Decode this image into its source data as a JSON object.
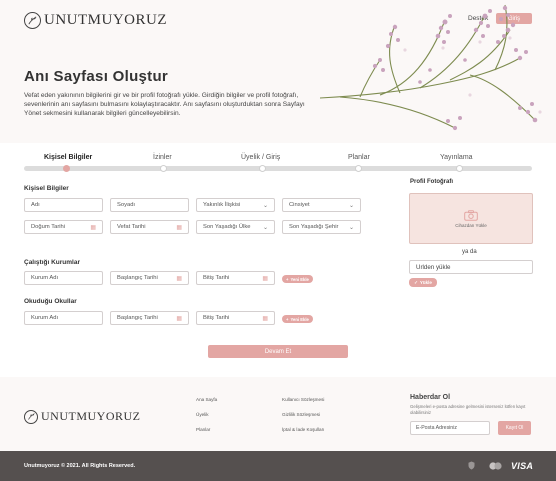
{
  "header": {
    "logo_text": "UNUTMUYORUZ",
    "support_link": "Destek",
    "login_button": "Giriş"
  },
  "hero": {
    "title": "Anı Sayfası Oluştur",
    "description": "Vefat eden yakınının bilgilerini gir ve bir profil fotoğrafı yükle. Girdiğin bilgiler ve profil fotoğrafı, sevenlerinin anı sayfasını bulmasını kolaylaştıracaktır. Anı sayfasını oluşturduktan sonra Sayfayı Yönet sekmesini kullanarak bilgileri güncelleyebilirsin."
  },
  "steps": [
    {
      "label": "Kişisel Bilgiler",
      "active": true
    },
    {
      "label": "İzinler",
      "active": false
    },
    {
      "label": "Üyelik / Giriş",
      "active": false
    },
    {
      "label": "Planlar",
      "active": false
    },
    {
      "label": "Yayınlama",
      "active": false
    }
  ],
  "personal": {
    "title": "Kişisel Bilgiler",
    "first_name": "Adı",
    "last_name": "Soyadı",
    "relation": "Yakınlık İlişkisi",
    "gender": "Cinsiyet",
    "birth_date": "Doğum Tarihi",
    "death_date": "Vefat Tarihi",
    "last_country": "Son Yaşadığı Ülke",
    "last_city": "Son Yaşadığı Şehir"
  },
  "work": {
    "title": "Çalıştığı Kurumlar",
    "institution": "Kurum Adı",
    "start_date": "Başlangıç Tarihi",
    "end_date": "Bitiş Tarihi",
    "add": "Yeni Ekle"
  },
  "school": {
    "title": "Okuduğu Okullar",
    "institution": "Kurum Adı",
    "start_date": "Başlangıç Tarihi",
    "end_date": "Bitiş Tarihi",
    "add": "Yeni Ekle"
  },
  "profile": {
    "title": "Profil Fotoğrafı",
    "upload_text": "Cihazdan Yükle",
    "or_text": "ya da",
    "url_label": "Urlden yükle",
    "url_button": "Yükle"
  },
  "submit_button": "Devam Et",
  "footer": {
    "logo_text": "UNUTMUYORUZ",
    "links_col1": [
      "Ana Sayfa",
      "Üyelik",
      "Planlar"
    ],
    "links_col2": [
      "Kullanıcı Sözleşmesi",
      "Gizlilik Sözleşmesi",
      "İptal & İade Koşulları"
    ],
    "newsletter_title": "Haberdar Ol",
    "newsletter_desc": "Gelişmeleri e-posta adresine gelmesini isterseniz lütfen kayıt olabilirsiniz",
    "email_placeholder": "E-Posta Adresiniz",
    "subscribe_button": "Kayıt Ol",
    "copyright": "Unutmuyoruz © 2021. All Rights Reserved.",
    "payment_visa": "VISA"
  },
  "colors": {
    "accent": "#e3a6a3",
    "bottom_bar": "#55504f",
    "upload_bg": "#f6e4e0"
  }
}
